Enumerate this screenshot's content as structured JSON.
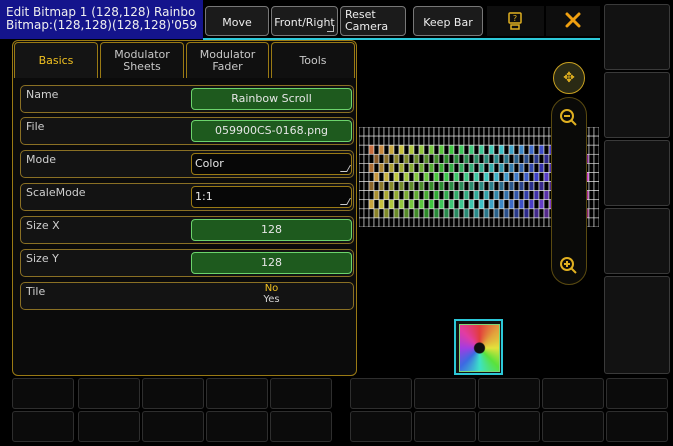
{
  "window": {
    "title_line1": "Edit Bitmap 1 (128,128) Rainbo",
    "title_line2": "Bitmap:(128,128)(128,128)'059"
  },
  "toolbar": {
    "move": "Move",
    "front_right": "Front/Right",
    "reset_camera_line1": "Reset",
    "reset_camera_line2": "Camera",
    "keep_bar": "Keep Bar",
    "help_icon": "help-icon",
    "close_icon": "close-icon"
  },
  "tabs": [
    {
      "line1": "Basics",
      "line2": "",
      "active": true
    },
    {
      "line1": "Modulator",
      "line2": "Sheets",
      "active": false
    },
    {
      "line1": "Modulator",
      "line2": "Fader",
      "active": false
    },
    {
      "line1": "Tools",
      "line2": "",
      "active": false
    }
  ],
  "properties": [
    {
      "name": "Name",
      "value": "Rainbow Scroll"
    },
    {
      "name": "File",
      "value": "059900CS-0168.png"
    },
    {
      "name": "Mode",
      "value": "Color"
    },
    {
      "name": "ScaleMode",
      "value": "1:1"
    },
    {
      "name": "Size X",
      "value": "128"
    },
    {
      "name": "Size Y",
      "value": "128"
    },
    {
      "name": "Tile",
      "value_line1": "No",
      "value_line2": "Yes"
    }
  ],
  "camera": {
    "pan_icon": "move-arrows-icon",
    "zoom_out_icon": "zoom-out-icon",
    "zoom_in_icon": "zoom-in-icon"
  },
  "colors": {
    "accent_gold": "#9a7a14",
    "accent_cyan": "#2cc8d8",
    "title_blue": "#14148c",
    "value_green": "#1e5a1e"
  }
}
